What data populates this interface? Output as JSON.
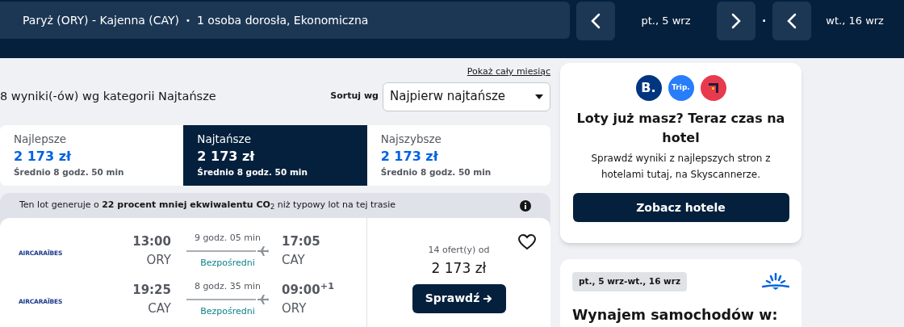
{
  "header": {
    "route": "Paryż (ORY) - Kajenna (CAY)",
    "route_separator": "•",
    "travellers": "1 osoba dorosła, Ekonomiczna",
    "depart_date": "pt., 5 wrz",
    "separator": "·",
    "return_date": "wt., 16 wrz"
  },
  "results": {
    "month_link": "Pokaż cały miesiąc",
    "summary": "8 wyniki(-ów) wg kategorii Najtańsze",
    "sort_label": "Sortuj wg",
    "sort_value": "Najpierw najtańsze"
  },
  "tabs": [
    {
      "label": "Najlepsze",
      "price": "2 173 zł",
      "duration": "Średnio 8 godz. 50 min",
      "selected": false
    },
    {
      "label": "Najtańsze",
      "price": "2 173 zł",
      "duration": "Średnio 8 godz. 50 min",
      "selected": true
    },
    {
      "label": "Najszybsze",
      "price": "2 173 zł",
      "duration": "Średnio 8 godz. 50 min",
      "selected": false
    }
  ],
  "flight_card": {
    "eco_note": "Ten lot generuje o **22 procent mniej ekwiwalentu CO**$_{2}$ niż typowy lot na tej trasie",
    "legs": [
      {
        "airline": "AIRCARAÏBES",
        "depart_time": "13:00",
        "depart_airport": "ORY",
        "duration": "9 godz. 05 min",
        "stops": "Bezpośredni",
        "arrive_time": "17:05",
        "arrive_airport": "CAY"
      },
      {
        "airline": "AIRCARAÏBES",
        "depart_time": "19:25",
        "depart_airport": "CAY",
        "duration": "8 godz. 35 min",
        "stops": "Bezpośredni",
        "arrive_time": "09:00$^{+1}$",
        "arrive_airport": "ORY"
      }
    ],
    "offers": "14 ofert(y) od",
    "price": "2 173 zł",
    "button": "Sprawdź",
    "saved": false
  },
  "hotel_card": {
    "logos": [
      {
        "text": "B.",
        "color": "#003580"
      },
      {
        "text": "Trip.",
        "color": "#287dfa"
      },
      {
        "color": "#e83a4f"
      }
    ],
    "title": "Loty już masz? Teraz czas na hotel",
    "body": "Sprawdź wyniki z najlepszych stron z hotelami tutaj, na Skyscannerze.",
    "button": "Zobacz hotele"
  },
  "car_card": {
    "dates": "pt., 5 wrz-wt., 16 wrz",
    "title": "Wynajem samochodów w:"
  }
}
